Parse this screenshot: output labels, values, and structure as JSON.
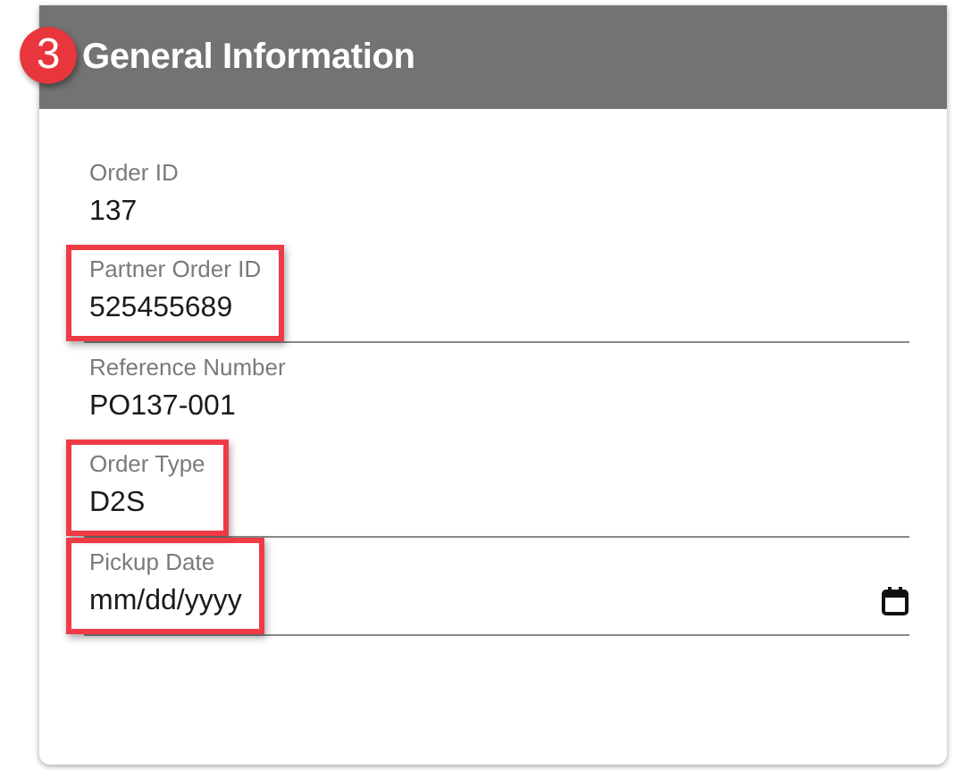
{
  "header": {
    "step": "3",
    "title": "General Information"
  },
  "fields": [
    {
      "kind": "readonly",
      "label": "Order ID",
      "value": "137",
      "highlighted": false
    },
    {
      "kind": "input",
      "label": "Partner Order ID",
      "value": "525455689",
      "highlighted": true
    },
    {
      "kind": "readonly",
      "label": "Reference Number",
      "value": "PO137-001",
      "highlighted": false
    },
    {
      "kind": "input",
      "label": "Order Type",
      "value": "D2S",
      "highlighted": true
    },
    {
      "kind": "date",
      "label": "Pickup Date",
      "placeholder": "mm/dd/yyyy",
      "highlighted": true
    }
  ]
}
